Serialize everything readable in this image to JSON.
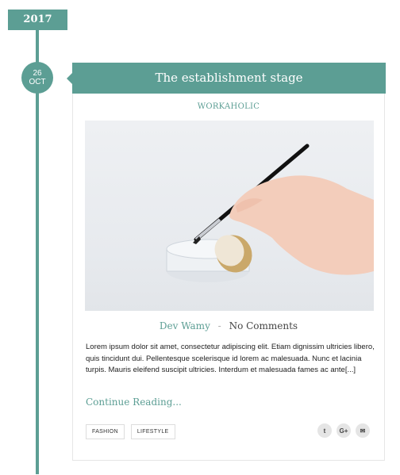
{
  "timeline": {
    "year": "2017"
  },
  "post": {
    "date": {
      "day": "26",
      "month": "OCT"
    },
    "title": "The establishment stage",
    "category": "WORKAHOLIC",
    "author": "Dev Wamy",
    "separator": "-",
    "comments": "No Comments",
    "excerpt": "Lorem ipsum dolor sit amet, consectetur adipiscing elit. Etiam dignissim ultricies libero, quis tincidunt dui. Pellentesque scelerisque id lorem ac malesuada. Nunc et lacinia turpis. Mauris eleifend suscipit ultricies. Interdum et malesuada fames ac ante[...]",
    "continue_label": "Continue Reading...",
    "tags": [
      "FASHION",
      "LIFESTYLE"
    ],
    "share": [
      {
        "icon": "twitter-icon",
        "glyph": "t"
      },
      {
        "icon": "google-plus-icon",
        "glyph": "G+"
      },
      {
        "icon": "email-icon",
        "glyph": "✉"
      }
    ]
  },
  "colors": {
    "accent": "#5c9e94",
    "text": "#222222",
    "border": "#e6e6e6"
  }
}
